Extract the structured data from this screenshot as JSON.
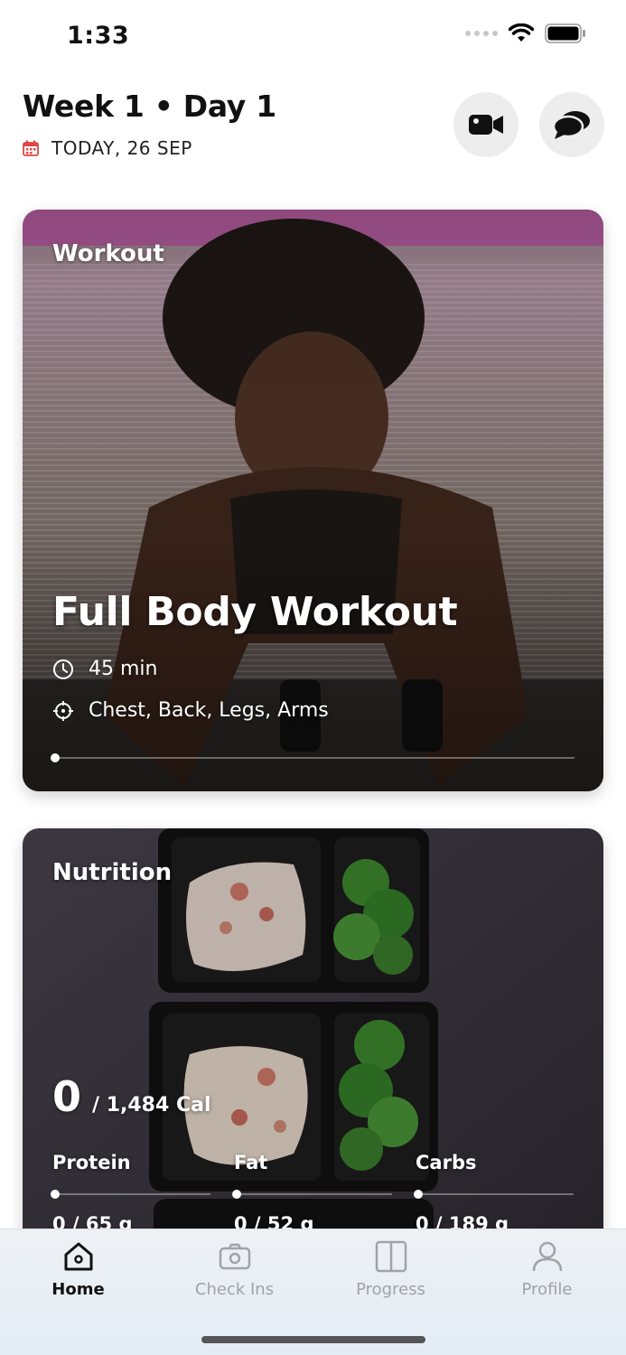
{
  "status_bar": {
    "time": "1:33"
  },
  "header": {
    "title": "Week 1 • Day 1",
    "date": "TODAY, 26 SEP",
    "video_button_icon": "video-camera-icon",
    "chat_button_icon": "chat-bubbles-icon"
  },
  "workout": {
    "label": "Workout",
    "title": "Full Body Workout",
    "duration": "45 min",
    "muscles": "Chest, Back, Legs, Arms",
    "progress": 0
  },
  "nutrition": {
    "label": "Nutrition",
    "calories_value": "0",
    "calories_goal": "/  1,484 Cal",
    "macros": [
      {
        "name": "Protein",
        "value": "0 / 65 g"
      },
      {
        "name": "Fat",
        "value": "0 / 52 g"
      },
      {
        "name": "Carbs",
        "value": "0 / 189 g"
      }
    ]
  },
  "tabs": [
    {
      "label": "Home",
      "icon": "home-icon",
      "active": true
    },
    {
      "label": "Check Ins",
      "icon": "camera-icon",
      "active": false
    },
    {
      "label": "Progress",
      "icon": "split-panel-icon",
      "active": false
    },
    {
      "label": "Profile",
      "icon": "person-icon",
      "active": false
    }
  ],
  "colors": {
    "accent_red": "#e04646",
    "tab_active": "#111111",
    "tab_inactive": "#a0a3a8"
  }
}
